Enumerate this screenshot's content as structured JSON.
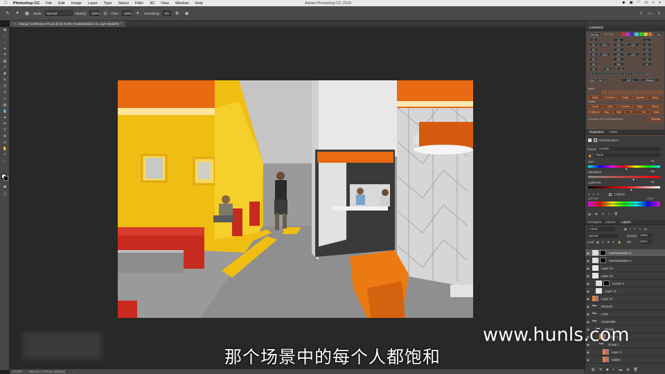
{
  "menubar": {
    "app": "Photoshop CC",
    "items": [
      "File",
      "Edit",
      "Image",
      "Layer",
      "Type",
      "Select",
      "Filter",
      "3D",
      "View",
      "Window",
      "Help"
    ],
    "window_title": "Adobe Photoshop CC 2018"
  },
  "options": {
    "mode_label": "Mode:",
    "mode_value": "Normal",
    "opacity_label": "Opacity:",
    "opacity_value": "100%",
    "flow_label": "Flow:",
    "flow_value": "100%",
    "smoothing_label": "Smoothing:",
    "smoothing_value": "0%"
  },
  "document": {
    "tab_title": "Orange Conference Room.tif @ 33.3% (Hue/Saturation 5, Layer Mask/8) *",
    "zoom": "33.33%",
    "doc_info": "4504 px x 2736 px (300 ppi)"
  },
  "luminosity": {
    "title": "Lumenzia",
    "preview_label": "Preview",
    "not_label": "Not",
    "grid_rows": [
      [
        "D",
        "",
        "M",
        "",
        "L"
      ],
      [
        "D2",
        "DM1",
        "M2",
        "LM1",
        "L2"
      ],
      [
        "D3",
        "",
        "M3",
        "",
        "L3"
      ],
      [
        "D4",
        "DM2",
        "M4",
        "LM2",
        "L4"
      ],
      [
        "D5",
        "",
        "M5",
        "",
        "L5"
      ],
      [
        "D6",
        "",
        "M6",
        "",
        "L6"
      ]
    ],
    "zone_labels": [
      "zD",
      "zM",
      "zL"
    ],
    "number_row": [
      "0",
      "1",
      "2",
      "3",
      "4",
      "5",
      "6",
      "7",
      "8",
      "9",
      "10"
    ],
    "vibe_row": [
      "Vibe",
      "Sat",
      "Diff +/-",
      "<Range>"
    ],
    "apply_label": "Apply",
    "apply_buttons": [
      "Mask",
      "Combine",
      "Dodge",
      "Vignette",
      "Sharp"
    ],
    "refine_label": "Refine",
    "refine_row1": [
      "Group",
      "Color",
      "Combine",
      "Edge",
      "History"
    ],
    "refine_row2": [
      "ProBlend",
      "Map",
      "Split",
      "If",
      "Sel",
      "Mask"
    ],
    "version": "Lumenzia v6.0.0 (Gregory Benz)",
    "tutorials": "Tutorials"
  },
  "properties": {
    "tabs": [
      "Properties",
      "Paths"
    ],
    "panel_title": "Hue/Saturation",
    "preset_label": "Preset:",
    "preset_value": "Custom",
    "channel_value": "Reds",
    "hue_label": "Hue:",
    "hue_value": "+6",
    "saturation_label": "Saturation:",
    "saturation_value": "+26",
    "lightness_label": "Lightness:",
    "lightness_value": "+21",
    "colorize_label": "Colorize",
    "range_left": "315°/345°",
    "range_right": "15°\\45°",
    "hue_position": 0.53,
    "saturation_position": 0.63,
    "lightness_position": 0.6
  },
  "layers": {
    "tabs": [
      "Histogram",
      "Actions",
      "Layers"
    ],
    "kind_label": "Kind",
    "blend_mode": "Normal",
    "opacity_label": "Opacity:",
    "opacity_value": "100%",
    "lock_label": "Lock:",
    "fill_label": "Fill:",
    "fill_value": "100%",
    "rows": [
      {
        "name": "Hue/Saturation 5",
        "kind": "adj"
      },
      {
        "name": "Hue/Saturation 4",
        "kind": "adj"
      },
      {
        "name": "Layer 14",
        "kind": "pixel"
      },
      {
        "name": "Layer 13",
        "kind": "pixel"
      },
      {
        "name": "Curves 4",
        "kind": "adj"
      },
      {
        "name": "Layer 12",
        "kind": "pixel"
      },
      {
        "name": "Layer 11",
        "kind": "photo"
      },
      {
        "name": "Retouch",
        "kind": "group"
      },
      {
        "name": "Color",
        "kind": "group"
      },
      {
        "name": "Composite",
        "kind": "group"
      },
      {
        "name": "People",
        "kind": "group"
      },
      {
        "name": "Layer 1",
        "kind": "photo"
      },
      {
        "name": "Group 1",
        "kind": "group"
      },
      {
        "name": "Layer 1",
        "kind": "photo"
      },
      {
        "name": "walker",
        "kind": "photo"
      }
    ]
  },
  "overlay": {
    "subtitle": "那个场景中的每个人都饱和",
    "watermark": "www.hunls.com"
  },
  "colors": {
    "accent_orange": "#e86a12",
    "yellow_wall": "#f2c416",
    "panel_bg": "#3c3c3c"
  }
}
